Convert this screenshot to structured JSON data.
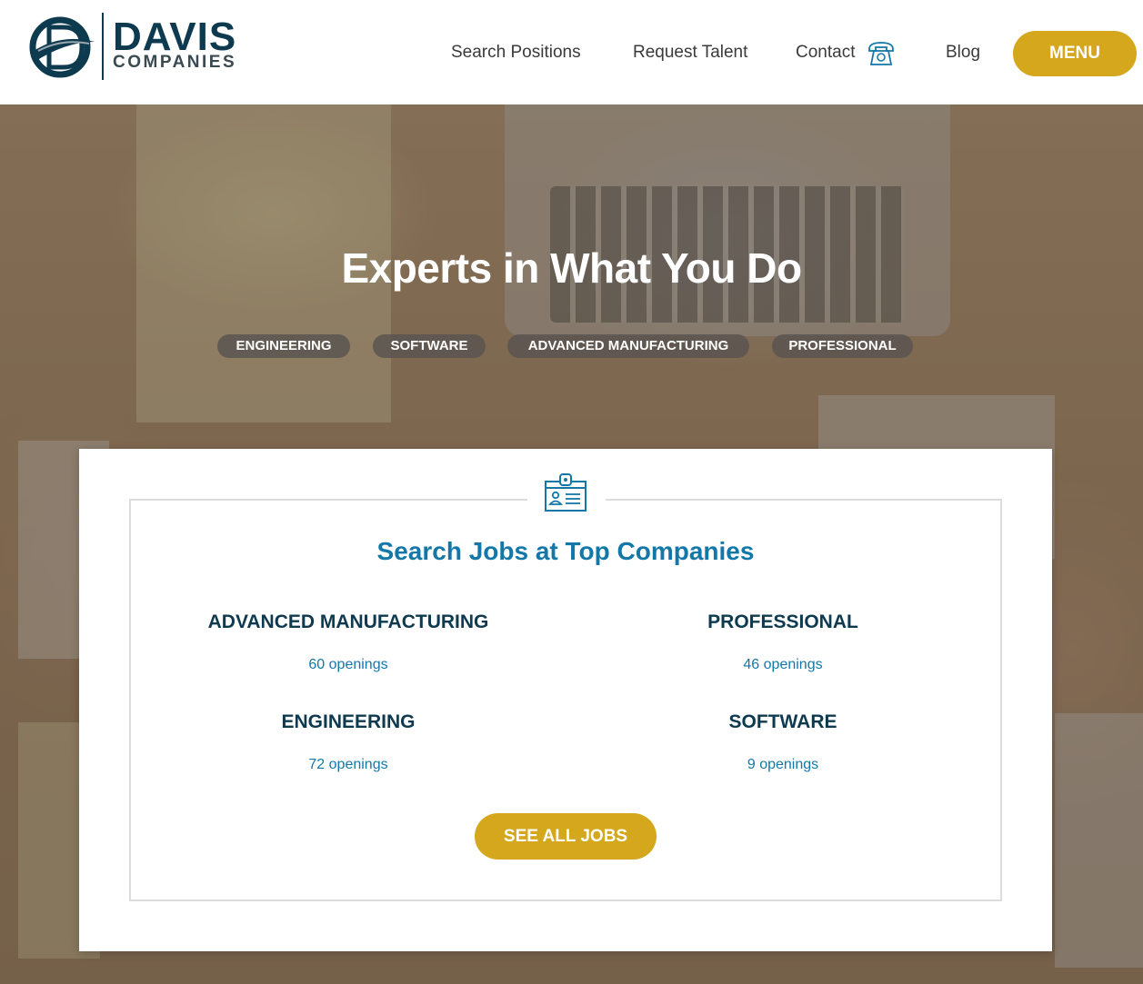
{
  "brand": {
    "name": "DAVIS",
    "tagline": "COMPANIES",
    "colors": {
      "navy": "#0e3a4f",
      "blue": "#1378a8",
      "gold": "#d4a71c"
    }
  },
  "nav": {
    "search_positions": "Search Positions",
    "request_talent": "Request Talent",
    "contact": "Contact",
    "contact_icon": "phone-icon",
    "blog": "Blog",
    "menu": "MENU"
  },
  "hero": {
    "title": "Experts in What You Do",
    "pills": [
      "ENGINEERING",
      "SOFTWARE",
      "ADVANCED MANUFACTURING",
      "PROFESSIONAL"
    ]
  },
  "jobs": {
    "icon": "id-badge-icon",
    "title": "Search Jobs at Top Companies",
    "categories": [
      {
        "name": "ADVANCED MANUFACTURING",
        "openings": "60 openings"
      },
      {
        "name": "PROFESSIONAL",
        "openings": "46 openings"
      },
      {
        "name": "ENGINEERING",
        "openings": "72 openings"
      },
      {
        "name": "SOFTWARE",
        "openings": "9 openings"
      }
    ],
    "see_all": "SEE ALL JOBS"
  }
}
